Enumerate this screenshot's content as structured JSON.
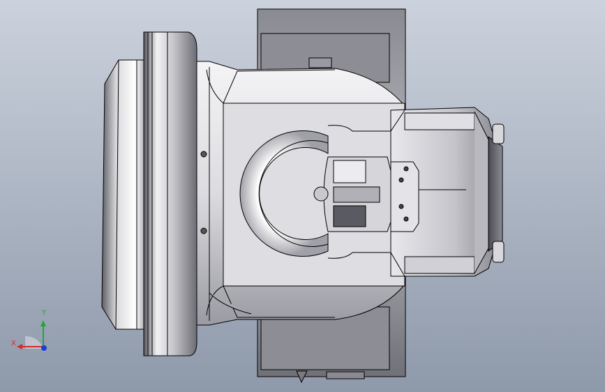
{
  "viewport": {
    "background_top": "#c9d0db",
    "background_bottom": "#8f9aab",
    "part_highlight": "#ffffff",
    "part_mid": "#b9b9bf",
    "part_shadow": "#4a4a52",
    "edge_color": "#000000"
  },
  "triad": {
    "x_label": "X",
    "y_label": "Y",
    "x_color": "#d42a2a",
    "y_color": "#1fa83a",
    "z_color": "#1a3fd6"
  }
}
